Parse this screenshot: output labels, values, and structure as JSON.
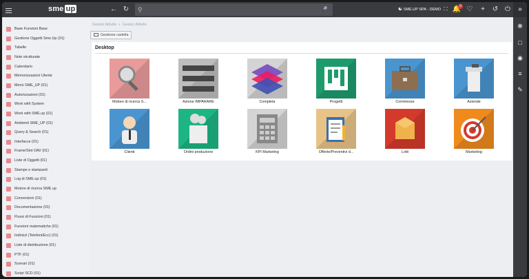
{
  "topbar": {
    "logo_main": "sme",
    "logo_up": "up",
    "company": "SME.UP SPA - DEMO",
    "notification_count": "0"
  },
  "sidebar": {
    "items": [
      {
        "label": "Base Funzioni Base"
      },
      {
        "label": "Gestione Oggetti Sme.Up (01)"
      },
      {
        "label": "Tabelle"
      },
      {
        "label": "Note strutturate"
      },
      {
        "label": "Calendario"
      },
      {
        "label": "Memorizzazioni Utente"
      },
      {
        "label": "Menù SME_UP (01)"
      },
      {
        "label": "Autorizzazioni (01)"
      },
      {
        "label": "Work with System"
      },
      {
        "label": "Work with SME.up (01)"
      },
      {
        "label": "Ambienti SME_UP (01)"
      },
      {
        "label": "Query & Search (01)"
      },
      {
        "label": "Interfacce (01)"
      },
      {
        "label": "Frame/Slot OAV (01)"
      },
      {
        "label": "Liste di Oggetti (01)"
      },
      {
        "label": "Stampe e stampanti"
      },
      {
        "label": "Log di SME.up (01)"
      },
      {
        "label": "Motore di ricerca SME.up"
      },
      {
        "label": "Conversioni (01)"
      },
      {
        "label": "Documentazione (01)"
      },
      {
        "label": "Flussi di Funzioni (01)"
      },
      {
        "label": "Funzioni matematiche (01)"
      },
      {
        "label": "Indirizzi (Telefoni/Ecc) (01)"
      },
      {
        "label": "Liste di distribuzione (01)"
      },
      {
        "label": "PTF (01)"
      },
      {
        "label": "Scenari (01)"
      },
      {
        "label": "Script SCD (01)"
      }
    ]
  },
  "breadcrumb": [
    "Gestori Attività",
    "»",
    "Gestori Attività"
  ],
  "gestione_label": "Gestione cartella",
  "desktop": {
    "title": "Desktop",
    "tiles": [
      {
        "label": "Motore di ricerca S...",
        "bg": "#e99b9c",
        "icon": "magnifier-icon"
      },
      {
        "label": "Azione IMPARARE",
        "bg": "#bdbdbd",
        "icon": "list-bars-icon"
      },
      {
        "label": "Completa",
        "bg": "#d4d4d4",
        "icon": "layers-icon"
      },
      {
        "label": "Progetti",
        "bg": "#1e9b6d",
        "icon": "kanban-icon"
      },
      {
        "label": "Commesse",
        "bg": "#4a95cf",
        "icon": "briefcase-icon"
      },
      {
        "label": "Aziende",
        "bg": "#4a95cf",
        "icon": "building-icon"
      },
      {
        "label": "Clienti",
        "bg": "#4a95cf",
        "icon": "person-icon"
      },
      {
        "label": "Ordini produzione",
        "bg": "#1eb584",
        "icon": "factory-icon"
      },
      {
        "label": "KPI Marketing",
        "bg": "#d4d4d4",
        "icon": "calculator-icon"
      },
      {
        "label": "Offerte/Preventivi d...",
        "bg": "#e8c388",
        "icon": "clipboard-icon"
      },
      {
        "label": "Lotti",
        "bg": "#d33a2b",
        "icon": "box-icon"
      },
      {
        "label": "Marketing",
        "bg": "#ef8a1c",
        "icon": "target-icon"
      }
    ]
  }
}
